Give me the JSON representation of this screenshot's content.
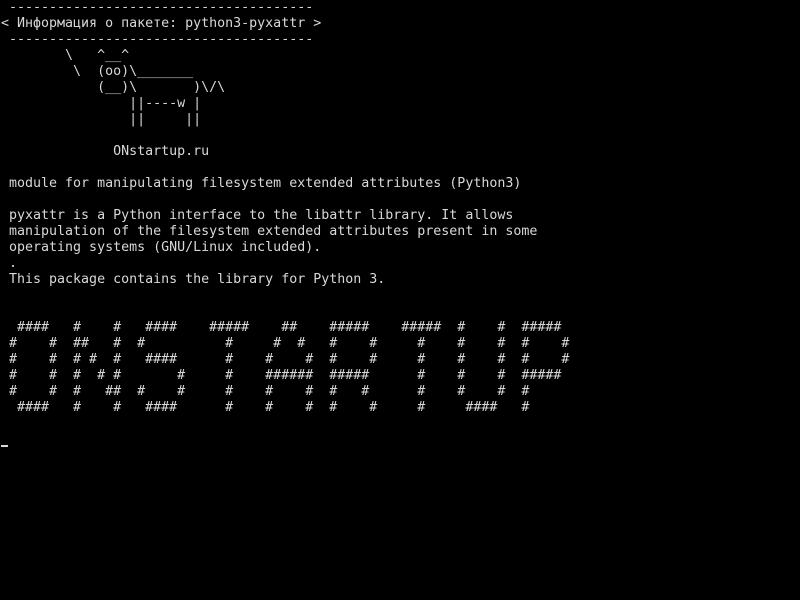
{
  "cowsay": {
    "top_border": " --------------------------------------",
    "message": "< Информация о пакете: python3-pyxattr >",
    "bottom_border": " --------------------------------------",
    "cow": [
      "        \\   ^__^",
      "         \\  (oo)\\_______",
      "            (__)\\       )\\/\\",
      "                ||----w |",
      "                ||     ||"
    ]
  },
  "site": "              ONstartup.ru",
  "description": {
    "summary": " module for manipulating filesystem extended attributes (Python3)",
    "body": [
      " pyxattr is a Python interface to the libattr library. It allows",
      " manipulation of the filesystem extended attributes present in some",
      " operating systems (GNU/Linux included).",
      " .",
      " This package contains the library for Python 3."
    ]
  },
  "banner": [
    "  ####   #    #   ####    #####    ##    #####    #####  #    #  #####",
    " #    #  ##   #  #          #     #  #   #    #     #    #    #  #    #",
    " #    #  # #  #   ####      #    #    #  #    #     #    #    #  #    #",
    " #    #  #  # #       #     #    ######  #####      #    #    #  #####",
    " #    #  #   ##  #    #     #    #    #  #   #      #    #    #  #",
    "  ####   #    #   ####      #    #    #  #    #     #     ####   #"
  ]
}
